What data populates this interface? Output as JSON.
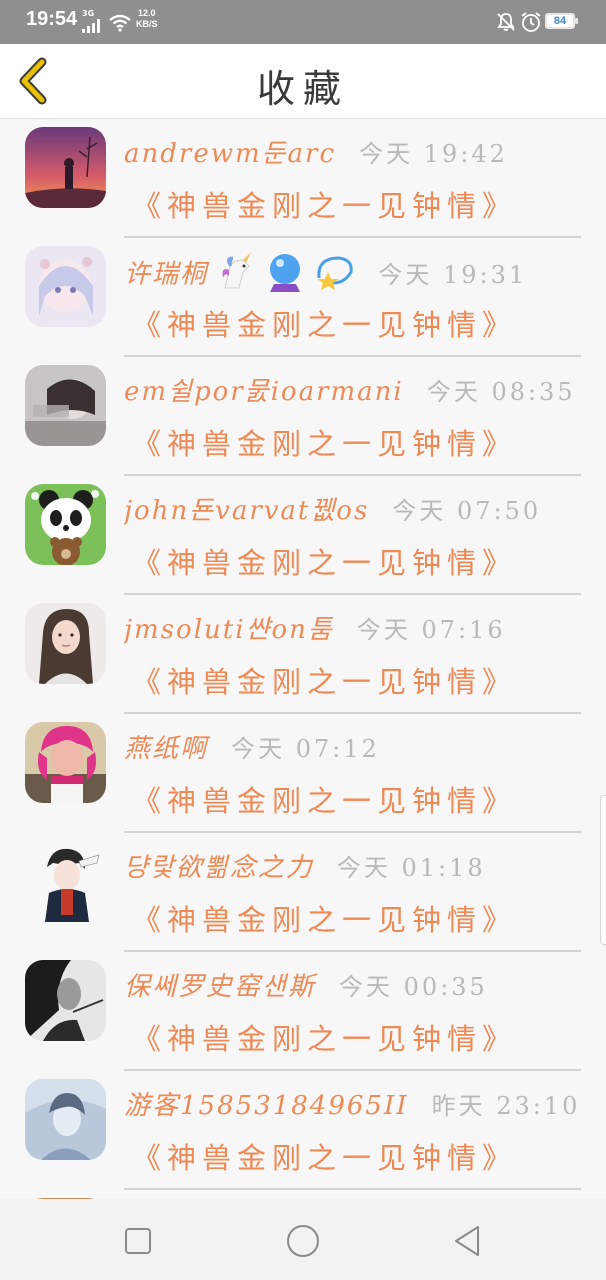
{
  "status_bar": {
    "time": "19:54",
    "network": "3G",
    "speed_value": "12.0",
    "speed_unit": "KB/S",
    "battery": "84"
  },
  "header": {
    "title": "收藏"
  },
  "items": [
    {
      "name": "andrewm둔arc",
      "time": "今天 19:42",
      "title": "《神兽金刚之一见钟情》",
      "avatar": "sunset-silhouette"
    },
    {
      "name": "许瑞桐",
      "emojis": [
        "unicorn",
        "crystal-ball",
        "dizzy-star"
      ],
      "time": "今天 19:31",
      "title": "《神兽金刚之一见钟情》",
      "avatar": "anime-girl"
    },
    {
      "name": "em쉴por뭀ioarmani",
      "time": "今天 08:35",
      "title": "《神兽金刚之一见钟情》",
      "avatar": "girl-photo"
    },
    {
      "name": "john됸varvat뀂os",
      "time": "今天 07:50",
      "title": "《神兽金刚之一见钟情》",
      "avatar": "panda"
    },
    {
      "name": "jmsoluti쌴on툼",
      "time": "今天 07:16",
      "title": "《神兽金刚之一见钟情》",
      "avatar": "woman-portrait"
    },
    {
      "name": "燕纸啊",
      "time": "今天 07:12",
      "title": "《神兽金刚之一见钟情》",
      "avatar": "pink-hair-character"
    },
    {
      "name": "댱랓欲뾞念之力",
      "time": "今天 01:18",
      "title": "《神兽金刚之一见钟情》",
      "avatar": "anime-boy"
    },
    {
      "name": "保쎄罗史窑샌斯",
      "time": "今天 00:35",
      "title": "《神兽金刚之一见钟情》",
      "avatar": "bw-portrait"
    },
    {
      "name": "游客15853184965II",
      "time": "昨天 23:10",
      "title": "《神兽金刚之一见钟情》",
      "avatar": "blue-portrait"
    }
  ],
  "colors": {
    "accent": "#ee8a56",
    "back_icon": "#e8c000",
    "time_text": "#b9b9b9"
  },
  "nav": {
    "icons": [
      "square-recent-icon",
      "circle-home-icon",
      "triangle-back-icon"
    ]
  }
}
